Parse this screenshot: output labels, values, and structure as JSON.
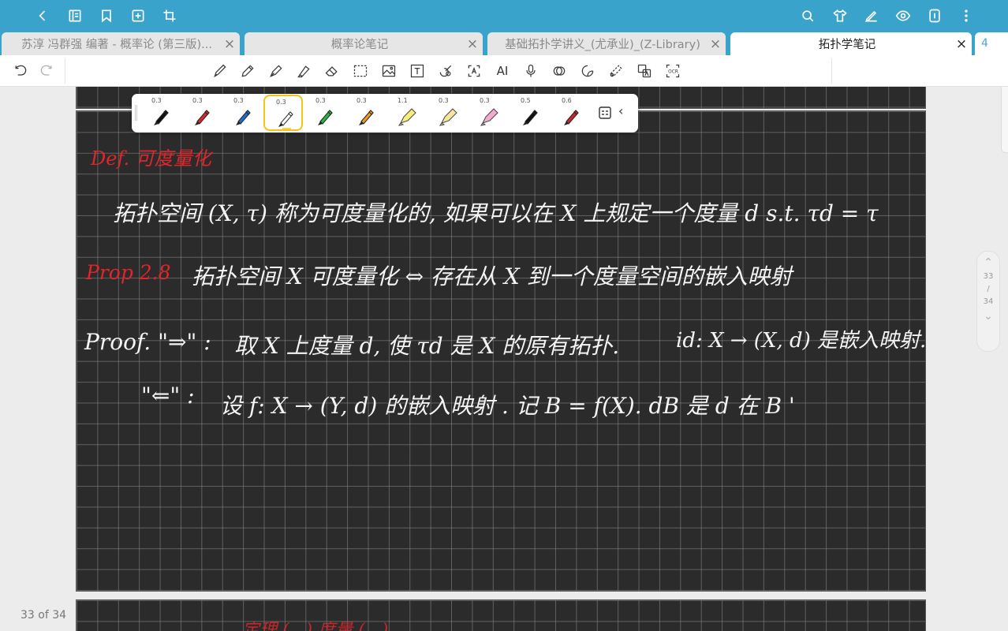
{
  "topbar": {
    "left_icons": [
      "back-icon",
      "outline-icon",
      "bookmark-icon",
      "add-page-icon",
      "crop-icon"
    ],
    "right_icons": [
      "search-icon",
      "shirt-icon",
      "pen-edit-icon",
      "eye-icon",
      "pencil-mode-icon",
      "more-icon"
    ]
  },
  "tabs": [
    {
      "label": "苏淳 冯群强 编著 - 概率论 (第三版)...",
      "close": "×",
      "active": false
    },
    {
      "label": "概率论笔记",
      "close": "×",
      "active": false
    },
    {
      "label": "基础拓扑学讲义_(尤承业)_(Z-Library)",
      "close": "×",
      "active": false
    },
    {
      "label": "拓扑学笔记",
      "close": "×",
      "active": true
    }
  ],
  "tab_overflow": "4",
  "toolbar": {
    "undo_icon": "undo-icon",
    "redo_icon": "redo-icon",
    "tools": [
      "pen-icon",
      "pencil-icon",
      "fountain-pen-icon",
      "highlighter-icon",
      "eraser-icon",
      "lasso-select-icon",
      "image-icon",
      "text-box-icon",
      "shape-icon",
      "text-recognition-icon",
      "ai-icon",
      "microphone-icon",
      "laser-pointer-icon",
      "sticker-icon",
      "tape-icon",
      "translate-icon",
      "ocr-icon"
    ],
    "ai_label": "AI"
  },
  "palette": {
    "pens": [
      {
        "size": "0.3",
        "color": "#111111",
        "type": "fineliner"
      },
      {
        "size": "0.3",
        "color": "#d9262b",
        "type": "fineliner"
      },
      {
        "size": "0.3",
        "color": "#1f6fd1",
        "type": "fineliner"
      },
      {
        "size": "0.3",
        "color": "#ffffff",
        "type": "fineliner",
        "selected": true
      },
      {
        "size": "0.3",
        "color": "#2fb344",
        "type": "fineliner"
      },
      {
        "size": "0.3",
        "color": "#f09a24",
        "type": "fineliner"
      },
      {
        "size": "1.1",
        "color": "#f6ee7a",
        "type": "highlighter"
      },
      {
        "size": "0.3",
        "color": "#f6e59a",
        "type": "highlighter"
      },
      {
        "size": "0.3",
        "color": "#f3a9d0",
        "type": "highlighter"
      },
      {
        "size": "0.5",
        "color": "#111111",
        "type": "fineliner"
      },
      {
        "size": "0.6",
        "color": "#c8262b",
        "type": "fineliner"
      }
    ],
    "menu_icon": "palette-settings-icon",
    "collapse": "‹"
  },
  "note": {
    "def_label": "Def. 可度量化",
    "def_text": "拓扑空间 (X, τ) 称为可度量化的, 如果可以在 X 上规定一个度量 d   s.t.  τd = τ",
    "prop_label": "Prop 2.8",
    "prop_text": "拓扑空间 X 可度量化 ⇔ 存在从 X 到一个度量空间的嵌入映射",
    "proof_label": "Proof. \"⇒\" :",
    "proof_line1a": "取 X 上度量 d, 使 τd 是 X 的原有拓扑.",
    "proof_line1b": "id: X → (X, d) 是嵌入映射.",
    "proof_line2_label": "\"⇐\" :",
    "proof_line2": "设 f:  X → (Y, d) 的嵌入映射 .     记 B = f(X).    dB 是 d 在 B '",
    "next_page_peek": "定理 (...)   度量 (...)"
  },
  "page_counter": "33 of 34",
  "scroller": {
    "up": "⌃",
    "current": "33",
    "sep": "/",
    "total": "34",
    "down": "⌄"
  }
}
